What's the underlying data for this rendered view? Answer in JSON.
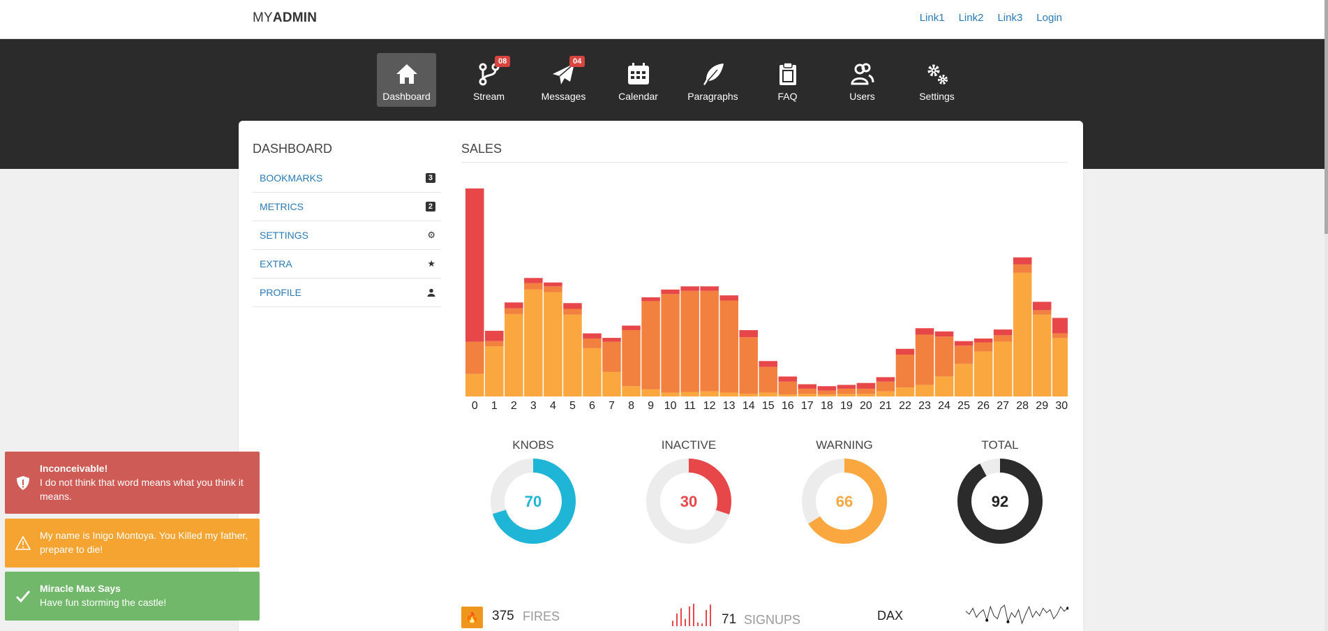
{
  "brand": {
    "prefix": "MY",
    "suffix": "ADMIN"
  },
  "top_links": [
    "Link1",
    "Link2",
    "Link3",
    "Login"
  ],
  "nav": [
    {
      "label": "Dashboard",
      "icon": "home-icon",
      "badge": ""
    },
    {
      "label": "Stream",
      "icon": "branch-icon",
      "badge": "08"
    },
    {
      "label": "Messages",
      "icon": "paper-plane-icon",
      "badge": "04"
    },
    {
      "label": "Calendar",
      "icon": "calendar-icon",
      "badge": ""
    },
    {
      "label": "Paragraphs",
      "icon": "feather-icon",
      "badge": ""
    },
    {
      "label": "FAQ",
      "icon": "clipboard-icon",
      "badge": ""
    },
    {
      "label": "Users",
      "icon": "users-icon",
      "badge": ""
    },
    {
      "label": "Settings",
      "icon": "gears-icon",
      "badge": ""
    }
  ],
  "sidebar": {
    "title": "DASHBOARD",
    "items": [
      {
        "label": "BOOKMARKS",
        "badge": "3"
      },
      {
        "label": "METRICS",
        "badge": "2"
      },
      {
        "label": "SETTINGS",
        "icon": "gear-icon"
      },
      {
        "label": "EXTRA",
        "icon": "star-icon"
      },
      {
        "label": "PROFILE",
        "icon": "user-icon"
      }
    ]
  },
  "sales": {
    "title": "SALES",
    "chart_data": {
      "type": "bar",
      "stacked": true,
      "categories": [
        "0",
        "1",
        "2",
        "3",
        "4",
        "5",
        "6",
        "7",
        "8",
        "9",
        "10",
        "11",
        "12",
        "13",
        "14",
        "15",
        "16",
        "17",
        "18",
        "19",
        "20",
        "21",
        "22",
        "23",
        "24",
        "25",
        "26",
        "27",
        "28",
        "29",
        "30"
      ],
      "series": [
        {
          "color": "#f9a73e",
          "values": [
            35,
            78,
            128,
            166,
            162,
            127,
            75,
            38,
            16,
            11,
            6,
            7,
            8,
            6,
            4,
            6,
            3,
            4,
            3,
            4,
            4,
            8,
            14,
            18,
            31,
            51,
            70,
            85,
            192,
            127,
            91
          ]
        },
        {
          "color": "#f2813f",
          "values": [
            50,
            8,
            9,
            10,
            9,
            9,
            15,
            47,
            87,
            137,
            153,
            157,
            156,
            143,
            88,
            40,
            20,
            8,
            6,
            8,
            8,
            15,
            51,
            78,
            62,
            28,
            14,
            10,
            13,
            7,
            7
          ]
        },
        {
          "color": "#e8474a",
          "values": [
            238,
            16,
            9,
            8,
            6,
            9,
            8,
            6,
            7,
            6,
            7,
            7,
            7,
            8,
            11,
            9,
            8,
            7,
            7,
            6,
            9,
            7,
            9,
            10,
            8,
            7,
            6,
            9,
            11,
            13,
            24
          ]
        }
      ]
    }
  },
  "gauges": [
    {
      "title": "KNOBS",
      "value": 70,
      "color": "#1fb5d6"
    },
    {
      "title": "INACTIVE",
      "value": 30,
      "color": "#e8474a"
    },
    {
      "title": "WARNING",
      "value": 66,
      "color": "#f9a73e"
    },
    {
      "title": "TOTAL",
      "value": 92,
      "color": "#2b2b2b"
    }
  ],
  "stats": {
    "fires": {
      "value": "375",
      "label": "FIRES"
    },
    "signups": {
      "value": "71",
      "label": "SIGNUPS",
      "spark": [
        6,
        14,
        20,
        8,
        22,
        25,
        4,
        3,
        18,
        24
      ]
    },
    "dax": {
      "label": "DAX",
      "spark": [
        10,
        8,
        12,
        6,
        9,
        11,
        4,
        13,
        7,
        5,
        12,
        14,
        3,
        9,
        6,
        11,
        2,
        8,
        13,
        6,
        10,
        7,
        12,
        9,
        11,
        5,
        8,
        13,
        10,
        12
      ]
    }
  },
  "toasts": [
    {
      "type": "error",
      "title": "Inconceivable!",
      "message": "I do not think that word means what you think it means."
    },
    {
      "type": "warning",
      "title": "",
      "message": "My name is Inigo Montoya. You Killed my father, prepare to die!"
    },
    {
      "type": "success",
      "title": "Miracle Max Says",
      "message": "Have fun storming the castle!"
    }
  ]
}
